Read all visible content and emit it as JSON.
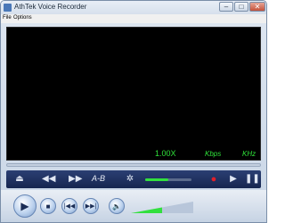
{
  "window": {
    "title": "AthTek Voice Recorder",
    "minimize_icon": "minimize-icon",
    "maximize_icon": "maximize-icon",
    "close_icon": "close-icon"
  },
  "menu": {
    "items": [
      {
        "label": "File"
      },
      {
        "label": "Options"
      }
    ]
  },
  "display": {
    "speed": "1.00X",
    "kbps": "Kbps",
    "khz": "KHz",
    "text_color": "#2fe23a"
  },
  "toolbar": {
    "ab_label": "A-B",
    "volume_level": 0.5
  },
  "colors": {
    "display_bg": "#000000",
    "toolbar_bg": "#1f3164",
    "record_red": "#e0202a",
    "accent_green": "#32e03e"
  }
}
